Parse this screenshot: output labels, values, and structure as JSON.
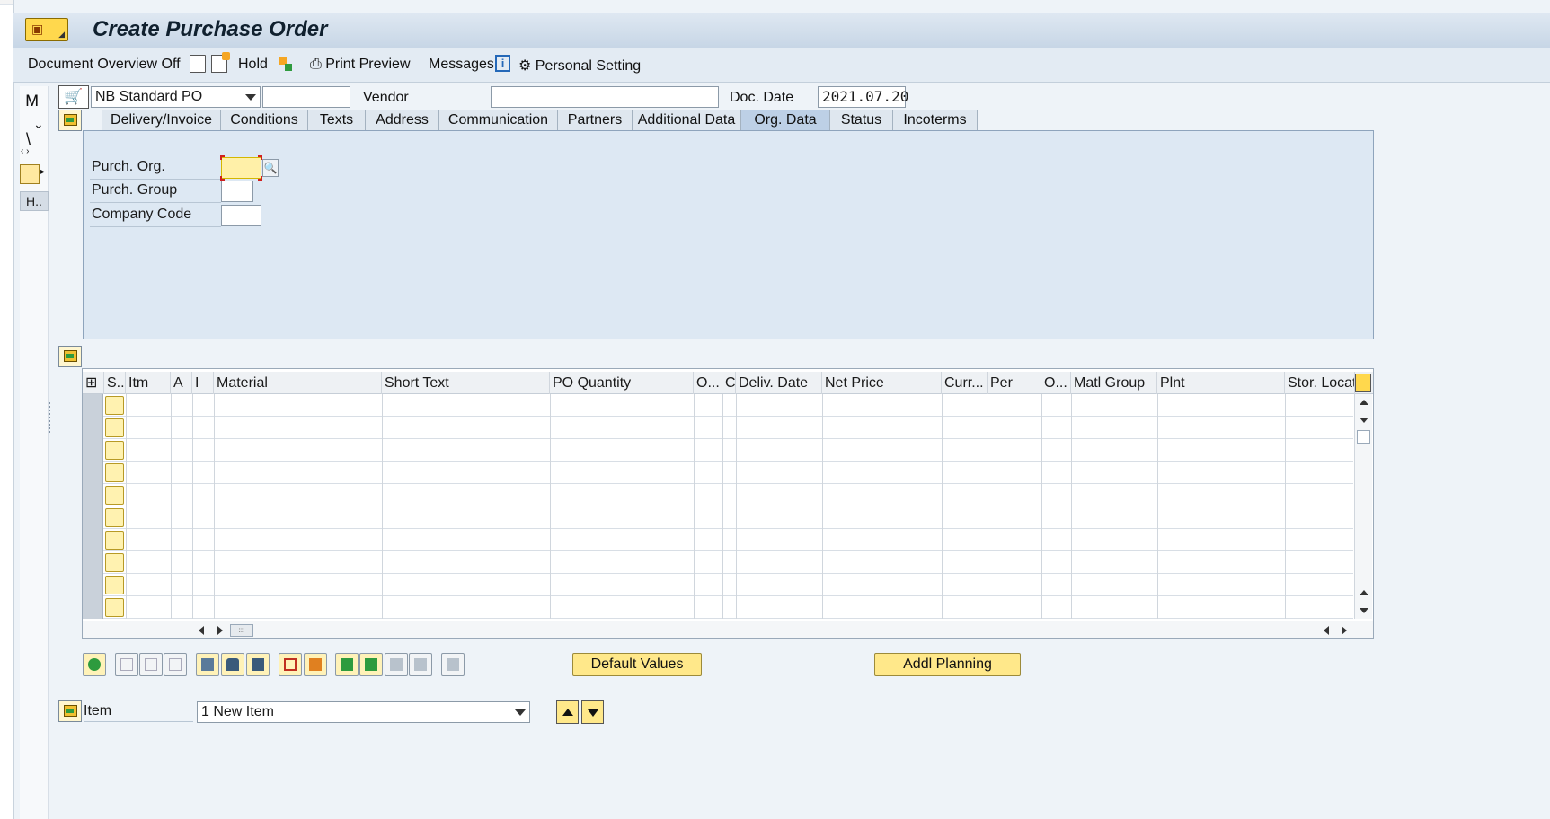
{
  "window": {
    "title": "Create Purchase Order"
  },
  "toolbar": {
    "document_overview": "Document Overview Off",
    "hold": "Hold",
    "print_preview": "Print Preview",
    "messages": "Messages",
    "personal_setting": "Personal Setting"
  },
  "leftstrip": {
    "collapsed_label": "H.."
  },
  "header": {
    "order_type": "NB Standard PO",
    "order_number": "",
    "vendor_label": "Vendor",
    "vendor_value": "",
    "doc_date_label": "Doc. Date",
    "doc_date_value": "2021.07.20"
  },
  "tabs": [
    {
      "label": "Delivery/Invoice"
    },
    {
      "label": "Conditions"
    },
    {
      "label": "Texts"
    },
    {
      "label": "Address"
    },
    {
      "label": "Communication"
    },
    {
      "label": "Partners"
    },
    {
      "label": "Additional Data"
    },
    {
      "label": "Org. Data",
      "active": true
    },
    {
      "label": "Status"
    },
    {
      "label": "Incoterms"
    }
  ],
  "org_data": {
    "purch_org_label": "Purch. Org.",
    "purch_org_value": "",
    "purch_group_label": "Purch. Group",
    "purch_group_value": "",
    "company_code_label": "Company Code",
    "company_code_value": ""
  },
  "grid": {
    "columns": [
      "S..",
      "Itm",
      "A",
      "I",
      "Material",
      "Short Text",
      "PO Quantity",
      "O...",
      "C",
      "Deliv. Date",
      "Net Price",
      "Curr...",
      "Per",
      "O...",
      "Matl Group",
      "Plnt",
      "Stor. Locati"
    ],
    "empty_rows": 10
  },
  "buttons": {
    "default_values": "Default Values",
    "addl_planning": "Addl Planning"
  },
  "item_nav": {
    "label": "Item",
    "selected": "1 New Item"
  },
  "colors": {
    "required_field": "#fff0a8",
    "active_tab": "#bdd0e6",
    "panel_bg": "#dde8f3",
    "button_yellow": "#ffe88a"
  }
}
